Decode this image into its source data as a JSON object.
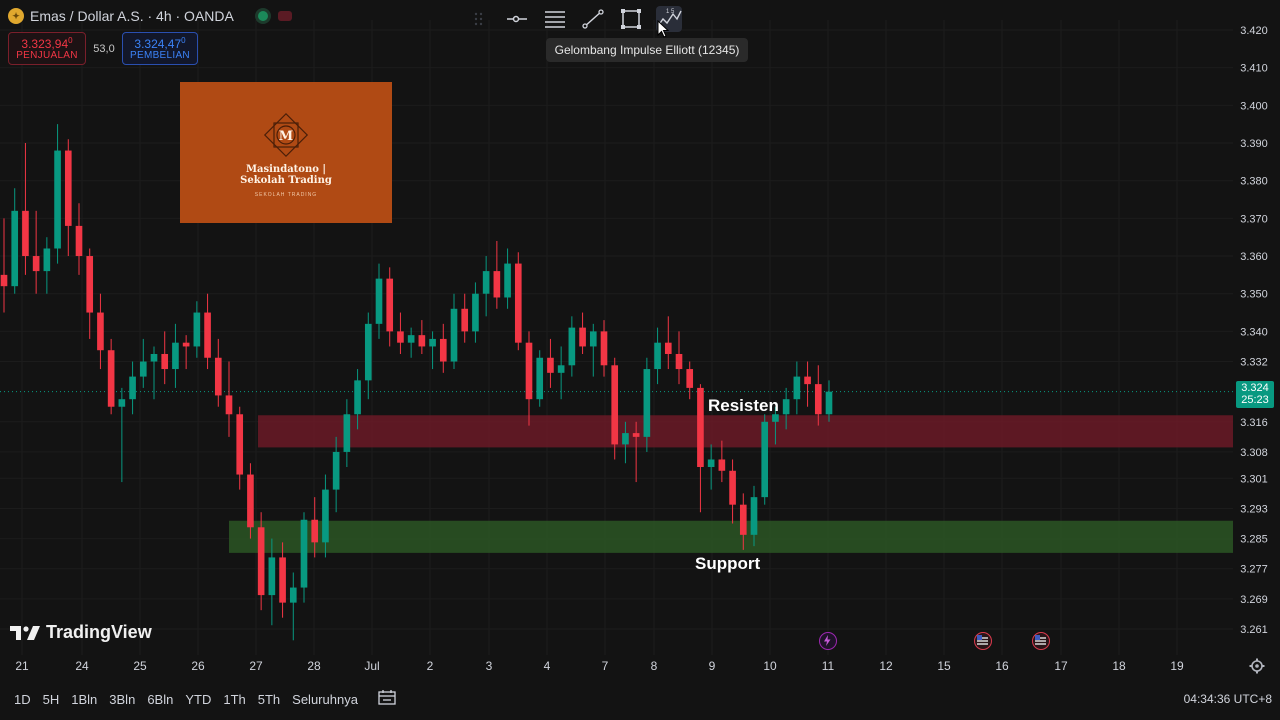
{
  "header": {
    "title": "Emas / Dollar A.S. · 4h · OANDA",
    "symbol_icon": "gold-coin-icon"
  },
  "quote": {
    "sell_price": "3.323,94",
    "sell_sup": "0",
    "sell_label": "PENJUALAN",
    "spread": "53,0",
    "buy_price": "3.324,47",
    "buy_sup": "0",
    "buy_label": "PEMBELIAN"
  },
  "drawing_toolbar": {
    "tools": [
      "drag-handle-icon",
      "horizontal-ray-icon",
      "fib-retracement-icon",
      "trend-line-icon",
      "rectangle-icon",
      "elliott-wave-icon"
    ],
    "elliott_glyph": "1 5",
    "tooltip": "Gelombang Impulse Elliott (12345)"
  },
  "watermark": {
    "initial": "M",
    "name_line1": "Masindatono |",
    "name_line2": "Sekolah Trading",
    "tagline": "SEKOLAH TRADING"
  },
  "zones": {
    "resistance_label": "Resisten",
    "support_label": "Support",
    "resistance_color": "#6b1a27",
    "support_color": "#2a5224"
  },
  "last_price": {
    "value": "3.324",
    "countdown": "25:23",
    "color": "#089981"
  },
  "branding": "TradingView",
  "bottom_bar": {
    "ranges": [
      "1D",
      "5H",
      "1Bln",
      "3Bln",
      "6Bln",
      "YTD",
      "1Th",
      "5Th",
      "Seluruhnya"
    ],
    "clock": "04:34:36 UTC+8"
  },
  "colors": {
    "up": "#089981",
    "down": "#f23645",
    "background": "#131313"
  },
  "chart_data": {
    "type": "candlestick",
    "timeframe": "4h",
    "price_axis_ticks": [
      3.42,
      3.41,
      3.4,
      3.39,
      3.38,
      3.37,
      3.36,
      3.35,
      3.34,
      3.332,
      3.316,
      3.308,
      3.301,
      3.293,
      3.285,
      3.277,
      3.269,
      3.261
    ],
    "price_axis_labels": [
      "3.420",
      "3.410",
      "3.400",
      "3.390",
      "3.380",
      "3.370",
      "3.360",
      "3.350",
      "3.340",
      "3.332",
      "3.316",
      "3.308",
      "3.301",
      "3.293",
      "3.285",
      "3.277",
      "3.269",
      "3.261"
    ],
    "time_axis_labels": [
      "21",
      "24",
      "25",
      "26",
      "27",
      "28",
      "Jul",
      "2",
      "3",
      "4",
      "7",
      "8",
      "9",
      "10",
      "11",
      "12",
      "15",
      "16",
      "17",
      "18",
      "19"
    ],
    "resistance_zone": [
      3.31,
      3.318
    ],
    "support_zone": [
      3.282,
      3.29
    ],
    "candles": [
      [
        3.355,
        3.37,
        3.345,
        3.352
      ],
      [
        3.352,
        3.378,
        3.35,
        3.372
      ],
      [
        3.372,
        3.39,
        3.355,
        3.36
      ],
      [
        3.36,
        3.372,
        3.35,
        3.356
      ],
      [
        3.356,
        3.365,
        3.35,
        3.362
      ],
      [
        3.362,
        3.395,
        3.358,
        3.388
      ],
      [
        3.388,
        3.391,
        3.36,
        3.368
      ],
      [
        3.368,
        3.374,
        3.355,
        3.36
      ],
      [
        3.36,
        3.362,
        3.338,
        3.345
      ],
      [
        3.345,
        3.35,
        3.33,
        3.335
      ],
      [
        3.335,
        3.338,
        3.318,
        3.32
      ],
      [
        3.32,
        3.325,
        3.3,
        3.322
      ],
      [
        3.322,
        3.332,
        3.318,
        3.328
      ],
      [
        3.328,
        3.338,
        3.325,
        3.332
      ],
      [
        3.332,
        3.336,
        3.322,
        3.334
      ],
      [
        3.334,
        3.34,
        3.326,
        3.33
      ],
      [
        3.33,
        3.342,
        3.325,
        3.337
      ],
      [
        3.337,
        3.339,
        3.33,
        3.336
      ],
      [
        3.336,
        3.348,
        3.333,
        3.345
      ],
      [
        3.345,
        3.35,
        3.33,
        3.333
      ],
      [
        3.333,
        3.338,
        3.32,
        3.323
      ],
      [
        3.323,
        3.332,
        3.312,
        3.318
      ],
      [
        3.318,
        3.32,
        3.298,
        3.302
      ],
      [
        3.302,
        3.305,
        3.285,
        3.288
      ],
      [
        3.288,
        3.292,
        3.266,
        3.27
      ],
      [
        3.27,
        3.285,
        3.262,
        3.28
      ],
      [
        3.28,
        3.284,
        3.264,
        3.268
      ],
      [
        3.268,
        3.276,
        3.258,
        3.272
      ],
      [
        3.272,
        3.292,
        3.268,
        3.29
      ],
      [
        3.29,
        3.296,
        3.28,
        3.284
      ],
      [
        3.284,
        3.302,
        3.28,
        3.298
      ],
      [
        3.298,
        3.312,
        3.292,
        3.308
      ],
      [
        3.308,
        3.322,
        3.304,
        3.318
      ],
      [
        3.318,
        3.33,
        3.314,
        3.327
      ],
      [
        3.327,
        3.345,
        3.322,
        3.342
      ],
      [
        3.342,
        3.358,
        3.338,
        3.354
      ],
      [
        3.354,
        3.357,
        3.336,
        3.34
      ],
      [
        3.34,
        3.345,
        3.334,
        3.337
      ],
      [
        3.337,
        3.341,
        3.333,
        3.339
      ],
      [
        3.339,
        3.343,
        3.334,
        3.336
      ],
      [
        3.336,
        3.34,
        3.33,
        3.338
      ],
      [
        3.338,
        3.342,
        3.329,
        3.332
      ],
      [
        3.332,
        3.35,
        3.33,
        3.346
      ],
      [
        3.346,
        3.35,
        3.337,
        3.34
      ],
      [
        3.34,
        3.353,
        3.337,
        3.35
      ],
      [
        3.35,
        3.36,
        3.344,
        3.356
      ],
      [
        3.356,
        3.364,
        3.346,
        3.349
      ],
      [
        3.349,
        3.362,
        3.346,
        3.358
      ],
      [
        3.358,
        3.361,
        3.335,
        3.337
      ],
      [
        3.337,
        3.34,
        3.315,
        3.322
      ],
      [
        3.322,
        3.335,
        3.32,
        3.333
      ],
      [
        3.333,
        3.338,
        3.325,
        3.329
      ],
      [
        3.329,
        3.336,
        3.322,
        3.331
      ],
      [
        3.331,
        3.344,
        3.328,
        3.341
      ],
      [
        3.341,
        3.345,
        3.334,
        3.336
      ],
      [
        3.336,
        3.342,
        3.328,
        3.34
      ],
      [
        3.34,
        3.343,
        3.328,
        3.331
      ],
      [
        3.331,
        3.333,
        3.306,
        3.31
      ],
      [
        3.31,
        3.316,
        3.305,
        3.313
      ],
      [
        3.313,
        3.316,
        3.3,
        3.312
      ],
      [
        3.312,
        3.333,
        3.308,
        3.33
      ],
      [
        3.33,
        3.341,
        3.326,
        3.337
      ],
      [
        3.337,
        3.344,
        3.33,
        3.334
      ],
      [
        3.334,
        3.34,
        3.326,
        3.33
      ],
      [
        3.33,
        3.332,
        3.322,
        3.325
      ],
      [
        3.325,
        3.326,
        3.292,
        3.304
      ],
      [
        3.304,
        3.31,
        3.298,
        3.306
      ],
      [
        3.306,
        3.311,
        3.3,
        3.303
      ],
      [
        3.303,
        3.306,
        3.289,
        3.294
      ],
      [
        3.294,
        3.297,
        3.282,
        3.286
      ],
      [
        3.286,
        3.299,
        3.283,
        3.296
      ],
      [
        3.296,
        3.318,
        3.294,
        3.316
      ],
      [
        3.316,
        3.32,
        3.31,
        3.318
      ],
      [
        3.318,
        3.325,
        3.314,
        3.322
      ],
      [
        3.322,
        3.332,
        3.318,
        3.328
      ],
      [
        3.328,
        3.332,
        3.32,
        3.326
      ],
      [
        3.326,
        3.331,
        3.315,
        3.318
      ],
      [
        3.318,
        3.327,
        3.316,
        3.324
      ]
    ]
  }
}
